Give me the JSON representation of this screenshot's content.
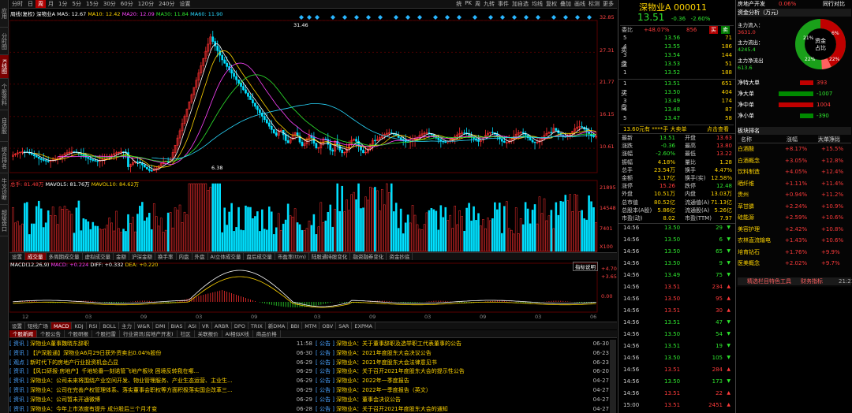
{
  "leftbar": [
    "应用",
    "分时图",
    "K线图",
    "个股资料",
    "自选股",
    "综合排名",
    "牛叉诊断",
    "超级盘口"
  ],
  "leftbar_active": 2,
  "periods": [
    "分时",
    "日",
    "周",
    "月",
    "1分",
    "5分",
    "15分",
    "30分",
    "60分",
    "120分",
    "240分",
    "设置"
  ],
  "periods_active": 2,
  "tools": [
    "统",
    "PK",
    "周",
    "九转",
    "事件",
    "",
    "加自选",
    "均线",
    "复权",
    "叠加",
    "画线",
    "标测",
    "更多"
  ],
  "ma_legend": {
    "name": "周线(复权)  深物业A",
    "ma5": "MA5: 12.67",
    "ma10": "MA10: 12.42",
    "ma20": "MA20: 12.09",
    "ma30": "MA30: 11.84",
    "ma60": "MA60: 11.90"
  },
  "price_axis": [
    "32.85",
    "27.31",
    "21.77",
    "16.15",
    "10.61"
  ],
  "high_label": "31.46",
  "low_label": "6.38",
  "vol_legend": {
    "a": "总手: 81.48万",
    "b": "MAVOL5: 81.76万",
    "c": "MAVOL10: 84.62万"
  },
  "vol_axis": [
    "21895",
    "14548",
    "7401",
    "X100"
  ],
  "toolrow": [
    "设置",
    "成交量",
    "多周期成交量",
    "虚拟成交量",
    "金额",
    "沪深金额",
    "换手率",
    "内盘",
    "外盘",
    "AI立体成交量",
    "盘后成交量",
    "市盈率(ttm)",
    "陆股通持股变化",
    "融资融券变化",
    "资金抄底"
  ],
  "toolrow_active": 1,
  "macd_legend": {
    "a": "MACD(12,26,9)",
    "b": "MACD: +0.224",
    "c": "DIFF: +0.332",
    "d": "DEA: +0.220"
  },
  "macd_axis": [
    "+4.70",
    "+3.65",
    "0.00"
  ],
  "zhibiao": "指标说明",
  "years": [
    "12",
    "03",
    "09",
    "03",
    "09",
    "03",
    "09",
    "03",
    "09",
    "03",
    "06"
  ],
  "idxrow": [
    "设置",
    "短线广场",
    "MACD",
    "KDJ",
    "RSI",
    "BOLL",
    "主力",
    "W&R",
    "DMI",
    "BIAS",
    "ASI",
    "VR",
    "ARBR",
    "DPO",
    "TRIX",
    "新DMA",
    "BBI",
    "MTM",
    "OBV",
    "SAR",
    "EXPMA"
  ],
  "idxrow_active": 2,
  "newstabs": [
    "个股新闻",
    "个股公告",
    "个股研报",
    "个股扫雷",
    "行业资讯(房地产开发)",
    "社区",
    "关联报价",
    "AI相似K线",
    "商品价格"
  ],
  "news_left": [
    {
      "tag": "资讯",
      "tx": "深物业A董事魏晓东辞职",
      "dt": "11:58"
    },
    {
      "tag": "资讯",
      "tx": "【沪深股通】深物业A6月29日获外资卖出0.04%股份",
      "dt": "06-30"
    },
    {
      "tag": "观点",
      "tx": "新时代下的房地产行业投资机会凸显",
      "dt": "06-29"
    },
    {
      "tag": "资讯",
      "tx": "【风口研报·房地产】千地轮番一刻诺管飞地产板块 困境反转我在哪...",
      "dt": "06-29"
    },
    {
      "tag": "资讯",
      "tx": "深物业A：公司未来将围绕产业空间开发、物业管理服务、产业生态运营、主业生...",
      "dt": "06-29"
    },
    {
      "tag": "资讯",
      "tx": "深物业A：公司在完善产权管理体系、落实董事会职权等方面积极落实国企改革三...",
      "dt": "06-29"
    },
    {
      "tag": "资讯",
      "tx": "深物业A：公司暂未开通微博",
      "dt": "06-29"
    },
    {
      "tag": "资讯",
      "tx": "深物业A：今年上市浓度有提升 成分股后三个月才变",
      "dt": "06-28"
    }
  ],
  "news_right": [
    {
      "tag": "公告",
      "tx": "深物业A：关于董事辞职及选举职工代表董事的公告",
      "dt": "06-30"
    },
    {
      "tag": "公告",
      "tx": "深物业A：2021年度股东大会决议公告",
      "dt": "06-23"
    },
    {
      "tag": "公告",
      "tx": "深物业A：2021年度股东大会法律意见书",
      "dt": "06-23"
    },
    {
      "tag": "公告",
      "tx": "深物业A：关于召开2021年度股东大会的提示性公告",
      "dt": "06-20"
    },
    {
      "tag": "公告",
      "tx": "深物业A：2022年一季度报告",
      "dt": "04-27"
    },
    {
      "tag": "公告",
      "tx": "深物业A：2022年一季度报告（英文）",
      "dt": "04-27"
    },
    {
      "tag": "公告",
      "tx": "深物业A：董事会决议公告",
      "dt": "04-27"
    },
    {
      "tag": "公告",
      "tx": "深物业A：关于召开2021年度股东大会的通知",
      "dt": "04-27"
    }
  ],
  "quote": {
    "name": "深物业A 000011",
    "price": "13.51",
    "chg": "-0.36",
    "pct": "-2.60%",
    "weibi_l": "委比",
    "weibi": "+48.07%",
    "weicha": "856",
    "buy": "买",
    "sell": "卖",
    "sells": [
      [
        "5",
        "13.56",
        "71"
      ],
      [
        "4",
        "13.55",
        "186"
      ],
      [
        "3",
        "13.54",
        "144"
      ],
      [
        "2",
        "13.53",
        "51"
      ],
      [
        "1",
        "13.52",
        "188"
      ]
    ],
    "buys": [
      [
        "1",
        "13.51",
        "651"
      ],
      [
        "2",
        "13.50",
        "404"
      ],
      [
        "3",
        "13.49",
        "174"
      ],
      [
        "4",
        "13.48",
        "87"
      ],
      [
        "5",
        "13.47",
        "58"
      ]
    ],
    "sell_l": [
      "卖",
      "盘"
    ],
    "buy_l": [
      "买",
      "盘"
    ],
    "bigorder": "13.60元有 ****手 大卖单",
    "clickview": "点击查看",
    "stats": [
      [
        "最新",
        "13.51",
        "开盘",
        "13.63"
      ],
      [
        "涨跌",
        "-0.36",
        "最高",
        "13.80"
      ],
      [
        "涨幅",
        "-2.60%",
        "最低",
        "13.22"
      ],
      [
        "振幅",
        "4.18%",
        "量比",
        "1.28"
      ],
      [
        "总手",
        "23.54万",
        "换手",
        "4.47%"
      ],
      [
        "金额",
        "3.17亿",
        "换手(实)",
        "12.58%"
      ],
      [
        "涨停",
        "15.26",
        "跌停",
        "12.48"
      ],
      [
        "外盘",
        "10.51万",
        "内盘",
        "13.03万"
      ],
      [
        "总市值",
        "80.52亿",
        "流通值(A)",
        "71.13亿"
      ],
      [
        "总股本(A股)",
        "5.86亿",
        "流通股(A)",
        "5.26亿"
      ],
      [
        "市盈(动)",
        "8.02",
        "市盈(TTM)",
        "7.97"
      ]
    ],
    "ticks": [
      [
        "14:56",
        "13.50",
        "29",
        "dn"
      ],
      [
        "14:56",
        "13.50",
        "6",
        "dn"
      ],
      [
        "14:56",
        "13.50",
        "65",
        "dn"
      ],
      [
        "14:56",
        "13.50",
        "9",
        "dn"
      ],
      [
        "14:56",
        "13.49",
        "75",
        "dn"
      ],
      [
        "14:56",
        "13.51",
        "234",
        "up"
      ],
      [
        "14:56",
        "13.50",
        "95",
        "up"
      ],
      [
        "14:56",
        "13.51",
        "30",
        "up"
      ],
      [
        "14:56",
        "13.51",
        "47",
        "dn"
      ],
      [
        "14:56",
        "13.50",
        "54",
        "dn"
      ],
      [
        "14:56",
        "13.51",
        "19",
        "dn"
      ],
      [
        "14:56",
        "13.50",
        "105",
        "dn"
      ],
      [
        "14:56",
        "13.51",
        "284",
        "up"
      ],
      [
        "14:56",
        "13.50",
        "173",
        "dn"
      ],
      [
        "14:56",
        "13.51",
        "22",
        "up"
      ],
      [
        "15:00",
        "13.51",
        "2451",
        "up"
      ]
    ]
  },
  "right": {
    "title": "房地产开发",
    "title_pct": "0.06%",
    "sameview": "同行对比",
    "fund_tab": "资金分析（万元）",
    "inflow_l": "主力流入：",
    "inflow": "3631.0",
    "outflow_l": "主力流出：",
    "outflow": "4245.4",
    "net_l": "主力净流出",
    "net": "613.6",
    "donut_center": [
      "资金",
      "占比"
    ],
    "donut_labels": [
      "21%",
      "6%",
      "22%",
      "22%"
    ],
    "bars": [
      [
        "净特大单",
        "393"
      ],
      [
        "净大单",
        "-1007"
      ],
      [
        "净中单",
        "1004"
      ],
      [
        "净小单",
        "-390"
      ]
    ],
    "rank_tab": "板块排名",
    "rank_hdr": [
      "名称",
      "涨幅",
      "大单净比"
    ],
    "rank": [
      [
        "白酒酸",
        "+8.17%",
        "+15.5%"
      ],
      [
        "白酒概念",
        "+3.05%",
        "+12.8%"
      ],
      [
        "饮料制造",
        "+4.05%",
        "+12.4%"
      ],
      [
        "晒纤维",
        "+1.11%",
        "+11.4%"
      ],
      [
        "贵州",
        "+0.94%",
        "+11.2%"
      ],
      [
        "草甘膦",
        "+2.24%",
        "+10.9%"
      ],
      [
        "硅能源",
        "+2.59%",
        "+10.6%"
      ],
      [
        "美容护理",
        "+2.42%",
        "+10.8%"
      ],
      [
        "农林直流输电",
        "+1.43%",
        "+10.6%"
      ],
      [
        "培育钻石",
        "+1.76%",
        "+9.9%"
      ],
      [
        "医美概念",
        "+2.02%",
        "+9.7%"
      ]
    ],
    "bottom": [
      "精选栏目",
      "",
      "特色工具",
      "财务指标"
    ],
    "time": "21:21"
  },
  "chart_data": {
    "type": "candlestick",
    "title": "",
    "xlabel": "",
    "ylabel": "",
    "ylim": [
      6.38,
      32.85
    ],
    "yticks": [
      10.61,
      16.15,
      21.77,
      27.31,
      32.85
    ],
    "x_ticks": [
      "12",
      "03",
      "09",
      "03",
      "09",
      "03",
      "09",
      "03",
      "09",
      "03",
      "06"
    ],
    "high": 31.46,
    "low": 6.38,
    "last": 13.51,
    "ma": {
      "MA5": 12.67,
      "MA10": 12.42,
      "MA20": 12.09,
      "MA30": 11.84,
      "MA60": 11.9
    },
    "volume_ticks": [
      7401,
      14548,
      21895
    ],
    "macd": {
      "MACD": 0.224,
      "DIFF": 0.332,
      "DEA": 0.22,
      "yticks": [
        0,
        3.65,
        4.7
      ]
    }
  }
}
